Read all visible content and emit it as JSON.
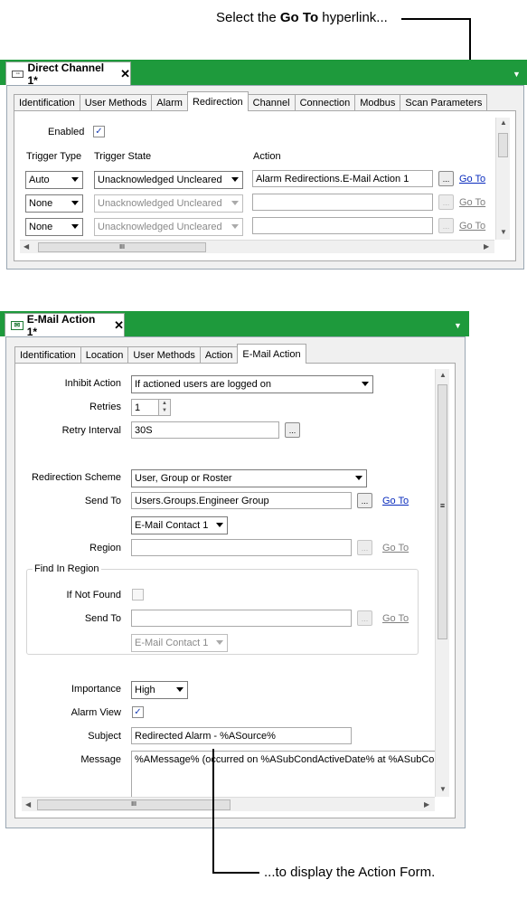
{
  "callouts": {
    "top_pre": "Select the ",
    "top_bold": "Go To",
    "top_post": " hyperlink...",
    "bottom": "...to display the Action Form."
  },
  "panel1": {
    "title": "Direct Channel 1*",
    "close": "✕",
    "tabs": [
      "Identification",
      "User Methods",
      "Alarm",
      "Redirection",
      "Channel",
      "Connection",
      "Modbus",
      "Scan Parameters"
    ],
    "enabled_label": "Enabled",
    "enabled_checked": "✓",
    "col_trigger_type": "Trigger Type",
    "col_trigger_state": "Trigger State",
    "col_action": "Action",
    "rows": [
      {
        "trigger_type": "Auto",
        "trigger_state": "Unacknowledged Uncleared",
        "action": "Alarm Redirections.E-Mail Action 1",
        "browse": "...",
        "goto": "Go To"
      },
      {
        "trigger_type": "None",
        "trigger_state": "Unacknowledged Uncleared",
        "action": "",
        "browse": "...",
        "goto": "Go To"
      },
      {
        "trigger_type": "None",
        "trigger_state": "Unacknowledged Uncleared",
        "action": "",
        "browse": "...",
        "goto": "Go To"
      }
    ],
    "scroll_grip": "III"
  },
  "panel2": {
    "title": "E-Mail Action 1*",
    "close": "✕",
    "tabs": [
      "Identification",
      "Location",
      "User Methods",
      "Action",
      "E-Mail Action"
    ],
    "inhibit_label": "Inhibit Action",
    "inhibit_value": "If actioned users are logged on",
    "retries_label": "Retries",
    "retries_value": "1",
    "retry_interval_label": "Retry Interval",
    "retry_interval_value": "30S",
    "browse": "...",
    "scheme_label": "Redirection Scheme",
    "scheme_value": "User, Group or Roster",
    "sendto_label": "Send To",
    "sendto_value": "Users.Groups.Engineer Group",
    "goto": "Go To",
    "contact_value": "E-Mail Contact 1",
    "region_label": "Region",
    "find_region_label": "Find In Region",
    "if_not_found_label": "If Not Found",
    "sendto2_label": "Send To",
    "contact2_value": "E-Mail Contact 1",
    "importance_label": "Importance",
    "importance_value": "High",
    "alarm_view_label": "Alarm View",
    "alarm_view_checked": "✓",
    "subject_label": "Subject",
    "subject_value": "Redirected Alarm - %ASource%",
    "message_label": "Message",
    "message_value": "%AMessage% (occurred on %ASubCondActiveDate% at %ASubCondA",
    "scroll_grip": "III",
    "vscroll_grip": "≡"
  }
}
